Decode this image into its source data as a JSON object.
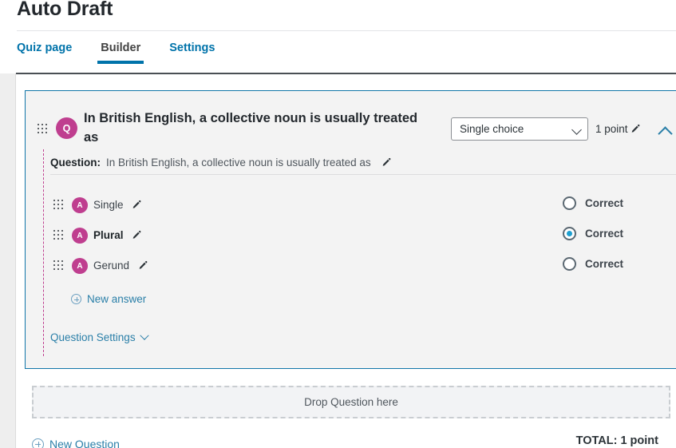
{
  "header": {
    "title": "Auto Draft"
  },
  "tabs": [
    {
      "label": "Quiz page",
      "active": false
    },
    {
      "label": "Builder",
      "active": true
    },
    {
      "label": "Settings",
      "active": false
    }
  ],
  "question": {
    "badge": "Q",
    "title": "In British English, a collective noun is usually treated as",
    "question_label": "Question:",
    "question_text": "In British English, a collective noun is usually treated as",
    "type_value": "Single choice",
    "type_options": [
      "Single choice"
    ],
    "points_label": "1 point",
    "new_answer_label": "New answer",
    "settings_label": "Question Settings",
    "answers": [
      {
        "badge": "A",
        "label": "Single",
        "correct_label": "Correct",
        "checked": false
      },
      {
        "badge": "A",
        "label": "Plural",
        "correct_label": "Correct",
        "checked": true
      },
      {
        "badge": "A",
        "label": "Gerund",
        "correct_label": "Correct",
        "checked": false
      }
    ]
  },
  "dropzone": {
    "label": "Drop Question here"
  },
  "footer": {
    "new_question_label": "New Question",
    "total_label": "TOTAL: 1 point"
  },
  "colors": {
    "accent_blue": "#0073aa",
    "badge_magenta": "#bf3e8f",
    "radio_checked": "#1e9fd0",
    "card_border": "#1076a8"
  }
}
